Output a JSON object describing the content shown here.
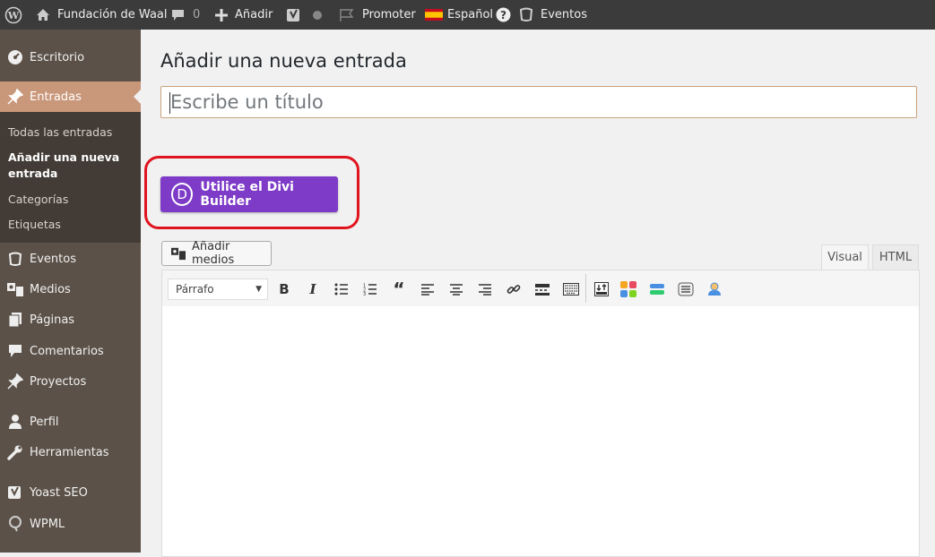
{
  "adminbar": {
    "site_name": "Fundación de Waal",
    "comments_count": "0",
    "add_new": "Añadir",
    "promoter": "Promoter",
    "language": "Español",
    "events": "Eventos",
    "icons": [
      "wordpress-icon",
      "home-icon",
      "comment-icon",
      "plus-icon",
      "yoast-icon",
      "status-dot-icon",
      "flag-icon",
      "spain-flag-icon",
      "help-icon",
      "events-icon"
    ]
  },
  "sidebar": {
    "items": [
      {
        "label": "Escritorio",
        "icon": "dashboard-icon"
      },
      {
        "label": "Entradas",
        "icon": "pin-icon"
      },
      {
        "label": "Eventos",
        "icon": "events-icon"
      },
      {
        "label": "Medios",
        "icon": "media-icon"
      },
      {
        "label": "Páginas",
        "icon": "pages-icon"
      },
      {
        "label": "Comentarios",
        "icon": "comment-icon"
      },
      {
        "label": "Proyectos",
        "icon": "pin-icon"
      },
      {
        "label": "Perfil",
        "icon": "user-icon"
      },
      {
        "label": "Herramientas",
        "icon": "wrench-icon"
      },
      {
        "label": "Yoast SEO",
        "icon": "yoast-icon"
      },
      {
        "label": "WPML",
        "icon": "wpml-icon"
      }
    ],
    "submenu": [
      {
        "label": "Todas las entradas"
      },
      {
        "label": "Añadir una nueva entrada"
      },
      {
        "label": "Categorías"
      },
      {
        "label": "Etiquetas"
      }
    ]
  },
  "main": {
    "page_title": "Añadir una nueva entrada",
    "title_placeholder": "Escribe un título",
    "divi_button": "Utilice el Divi Builder",
    "divi_logo_letter": "D",
    "add_media": "Añadir medios",
    "tabs": {
      "visual": "Visual",
      "html": "HTML"
    },
    "format_select": "Párrafo",
    "toolbar_icons": [
      "bold-icon",
      "italic-icon",
      "bullet-list-icon",
      "numbered-list-icon",
      "blockquote-icon",
      "align-left-icon",
      "align-center-icon",
      "align-right-icon",
      "link-icon",
      "read-more-icon",
      "toolbar-toggle-icon",
      "insert-icon",
      "modules-icon",
      "divider-icon",
      "list-icon",
      "user-icon"
    ]
  },
  "colors": {
    "adminbar_bg": "#3b3b3b",
    "sidebar_bg": "#5b5148",
    "submenu_bg": "#433c36",
    "current_menu_bg": "#c9977a",
    "divi_button_bg": "#7d3bc7",
    "highlight_border": "#e0141e"
  }
}
